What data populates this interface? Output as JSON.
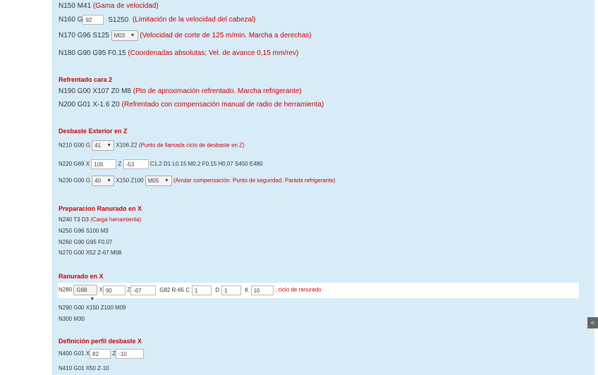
{
  "l1": {
    "code": "N150 M41",
    "note": "(Gama de velocidad)"
  },
  "l2": {
    "code": "N160 G",
    "input": "92",
    "code2": "S1250",
    "note": "(Limitación de la velocidad del cabezal)"
  },
  "l3": {
    "code": "N170 G96 S125",
    "select": "M03",
    "note": "(Velocidad de corte de 125 m/min. Marcha a derechas)"
  },
  "l4": {
    "code": "N180 G90 G95 F0.15",
    "note": "(Coordenadas absolutas; Vel. de avance 0,15 mm/rev)"
  },
  "h1": "Refrentado cara 2",
  "l5": {
    "code": "N190 G00 X107 Z0 M8",
    "note": "(Pto de aproximación refrentado. Marcha refrigerante)"
  },
  "l6": {
    "code": "N200 G01 X-1.6 Z0",
    "note": "(Refrentado con compensación manual de radio de herramienta)"
  },
  "h2": "Desbaste Exterior en Z",
  "l7": {
    "code": "N210 G00 G",
    "select": "41",
    "code2": "X106 Z2",
    "note": "(Punto de llamada ciclo de desbaste en Z)"
  },
  "l8": {
    "code": "N220 G69 X",
    "x": "105",
    "zlbl": "Z",
    "z": "-53",
    "rest": "C1.2 D1 L0.15 M0.2 F0.15 H0.07 S450 E480"
  },
  "l9": {
    "code": "N230 G00 G",
    "select": "40",
    "code2": "X150 Z100",
    "select2": "M05",
    "note": "(Anular compensación. Punto de seguridad. Parada refrigerante)"
  },
  "h3": "Preparacion Ranurado en X",
  "l10": {
    "code": "N240 T3 D3",
    "note": "(Carga herramienta)"
  },
  "l11": "N250 G96 S100 M3",
  "l12": "N260 G90 G95 F0.07",
  "l13": "N270 G00 X52 Z-67 M08",
  "h4": "Ranurado en X",
  "l14": {
    "code": "N280",
    "select": "G88",
    "xl": "X",
    "x": "90",
    "zl": "Z",
    "z": "-67",
    "mid": "G82 R-65 C",
    "c": "1",
    "dl": "D",
    "d": "1",
    "kl": "K",
    "k": "10",
    "note": "; ciclo de ranurado"
  },
  "l15": "N290 G00 X150 Z100 M09",
  "l16": "N300 M30",
  "h5": "Definición perfil desbaste X",
  "l17": {
    "code": "N400 G01",
    "xl": "X",
    "x": "82",
    "zl": "Z",
    "z": "-10"
  },
  "l18": "N410 G01 X50 Z-10",
  "scroll_label": "<"
}
